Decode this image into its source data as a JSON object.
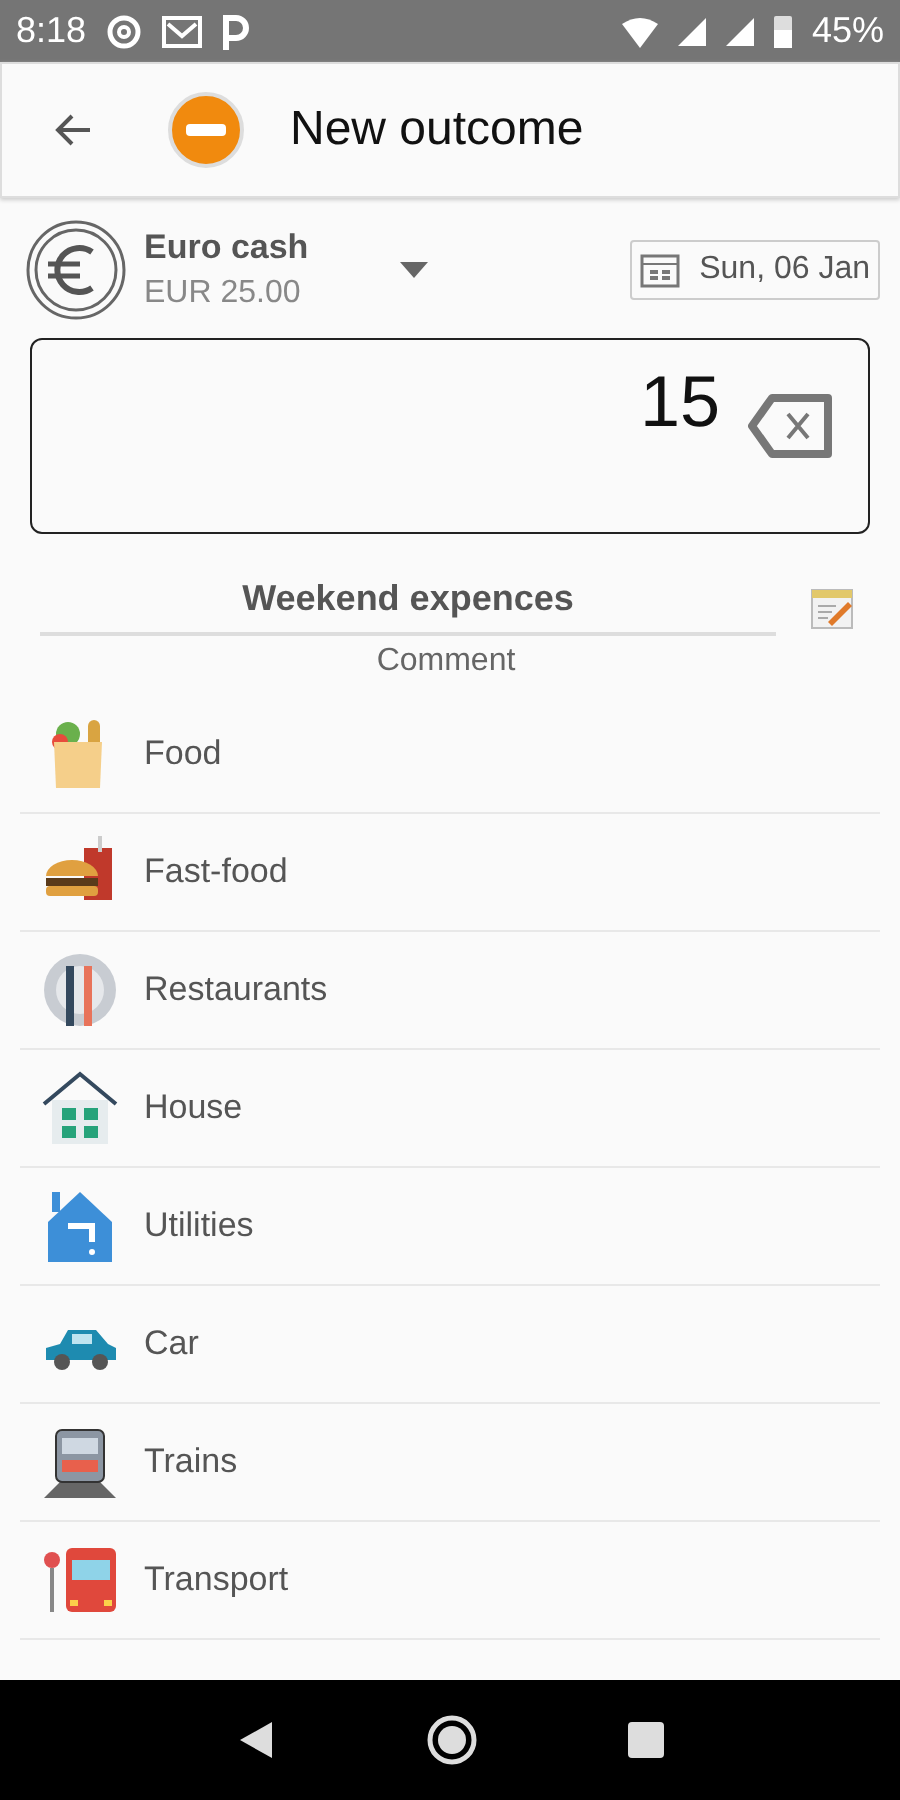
{
  "status_bar": {
    "time": "8:18",
    "battery": "45%"
  },
  "header": {
    "title": "New outcome"
  },
  "account": {
    "name": "Euro cash",
    "balance": "EUR 25.00",
    "date": "Sun, 06 Jan"
  },
  "amount": {
    "value": "15"
  },
  "comment": {
    "value": "Weekend expences",
    "label": "Comment"
  },
  "categories": [
    {
      "label": "Food",
      "kind": "food"
    },
    {
      "label": "Fast-food",
      "kind": "fastfood"
    },
    {
      "label": "Restaurants",
      "kind": "restaurant"
    },
    {
      "label": "House",
      "kind": "house"
    },
    {
      "label": "Utilities",
      "kind": "utilities"
    },
    {
      "label": "Car",
      "kind": "car"
    },
    {
      "label": "Trains",
      "kind": "train"
    },
    {
      "label": "Transport",
      "kind": "bus"
    }
  ]
}
